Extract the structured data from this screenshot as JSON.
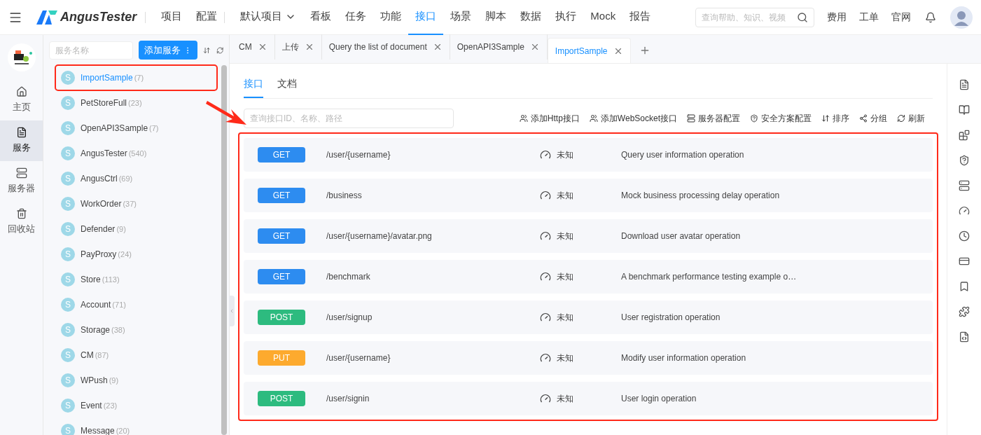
{
  "header": {
    "brand": "AngusTester",
    "nav": [
      {
        "label": "项目",
        "selected": false,
        "kind": "link"
      },
      {
        "label": "配置",
        "selected": false,
        "kind": "link"
      },
      {
        "label": "默认项目",
        "selected": false,
        "kind": "dropdown"
      },
      {
        "label": "看板",
        "selected": false,
        "kind": "link"
      },
      {
        "label": "任务",
        "selected": false,
        "kind": "link"
      },
      {
        "label": "功能",
        "selected": false,
        "kind": "link"
      },
      {
        "label": "接口",
        "selected": true,
        "kind": "link"
      },
      {
        "label": "场景",
        "selected": false,
        "kind": "link"
      },
      {
        "label": "脚本",
        "selected": false,
        "kind": "link"
      },
      {
        "label": "数据",
        "selected": false,
        "kind": "link"
      },
      {
        "label": "执行",
        "selected": false,
        "kind": "link"
      },
      {
        "label": "Mock",
        "selected": false,
        "kind": "link"
      },
      {
        "label": "报告",
        "selected": false,
        "kind": "link"
      }
    ],
    "search": {
      "placeholder": "查询帮助、知识、视频"
    },
    "links": [
      "费用",
      "工单",
      "官网"
    ]
  },
  "left_nav": [
    {
      "label": "主页",
      "selected": false,
      "kind": "home"
    },
    {
      "label": "服务",
      "selected": true,
      "kind": "service"
    },
    {
      "label": "服务器",
      "selected": false,
      "kind": "server"
    },
    {
      "label": "回收站",
      "selected": false,
      "kind": "trash"
    }
  ],
  "services": {
    "search": {
      "placeholder": "服务名称"
    },
    "add_button": "添加服务",
    "items": [
      {
        "avatar": "S",
        "name": "ImportSample",
        "count": "(7)",
        "selected": true
      },
      {
        "avatar": "S",
        "name": "PetStoreFull",
        "count": "(23)",
        "selected": false
      },
      {
        "avatar": "S",
        "name": "OpenAPI3Sample",
        "count": "(7)",
        "selected": false
      },
      {
        "avatar": "S",
        "name": "AngusTester",
        "count": "(540)",
        "selected": false
      },
      {
        "avatar": "S",
        "name": "AngusCtrl",
        "count": "(69)",
        "selected": false
      },
      {
        "avatar": "S",
        "name": "WorkOrder",
        "count": "(37)",
        "selected": false
      },
      {
        "avatar": "S",
        "name": "Defender",
        "count": "(9)",
        "selected": false
      },
      {
        "avatar": "S",
        "name": "PayProxy",
        "count": "(24)",
        "selected": false
      },
      {
        "avatar": "S",
        "name": "Store",
        "count": "(113)",
        "selected": false
      },
      {
        "avatar": "S",
        "name": "Account",
        "count": "(71)",
        "selected": false
      },
      {
        "avatar": "S",
        "name": "Storage",
        "count": "(38)",
        "selected": false
      },
      {
        "avatar": "S",
        "name": "CM",
        "count": "(87)",
        "selected": false
      },
      {
        "avatar": "S",
        "name": "WPush",
        "count": "(9)",
        "selected": false
      },
      {
        "avatar": "S",
        "name": "Event",
        "count": "(23)",
        "selected": false
      },
      {
        "avatar": "S",
        "name": "Message",
        "count": "(20)",
        "selected": false
      }
    ]
  },
  "tabs": [
    {
      "label": "CM",
      "selected": false
    },
    {
      "label": "上传",
      "selected": false
    },
    {
      "label": "Query the list of document",
      "selected": false
    },
    {
      "label": "OpenAPI3Sample",
      "selected": false
    },
    {
      "label": "ImportSample",
      "selected": true
    }
  ],
  "sub_tabs": [
    {
      "label": "接口",
      "selected": true
    },
    {
      "label": "文档",
      "selected": false
    }
  ],
  "api_search": {
    "placeholder": "查询接口ID、名称、路径"
  },
  "toolbar": [
    {
      "label": "添加Http接口",
      "kind": "add"
    },
    {
      "label": "添加WebSocket接口",
      "kind": "add"
    },
    {
      "label": "服务器配置",
      "kind": "server"
    },
    {
      "label": "安全方案配置",
      "kind": "shield"
    },
    {
      "label": "排序",
      "kind": "sort"
    },
    {
      "label": "分组",
      "kind": "group"
    },
    {
      "label": "刷新",
      "kind": "refresh"
    }
  ],
  "apis": [
    {
      "method": "GET",
      "kind": "get",
      "path": "/user/{username}",
      "status": "未知",
      "summary": "Query user information operation"
    },
    {
      "method": "GET",
      "kind": "get",
      "path": "/business",
      "status": "未知",
      "summary": "Mock business processing delay operation"
    },
    {
      "method": "GET",
      "kind": "get",
      "path": "/user/{username}/avatar.png",
      "status": "未知",
      "summary": "Download user avatar operation"
    },
    {
      "method": "GET",
      "kind": "get",
      "path": "/benchmark",
      "status": "未知",
      "summary": "A benchmark performance testing example o…"
    },
    {
      "method": "POST",
      "kind": "post",
      "path": "/user/signup",
      "status": "未知",
      "summary": "User registration operation"
    },
    {
      "method": "PUT",
      "kind": "put",
      "path": "/user/{username}",
      "status": "未知",
      "summary": "Modify user information operation"
    },
    {
      "method": "POST",
      "kind": "post",
      "path": "/user/signin",
      "status": "未知",
      "summary": "User login operation"
    }
  ]
}
